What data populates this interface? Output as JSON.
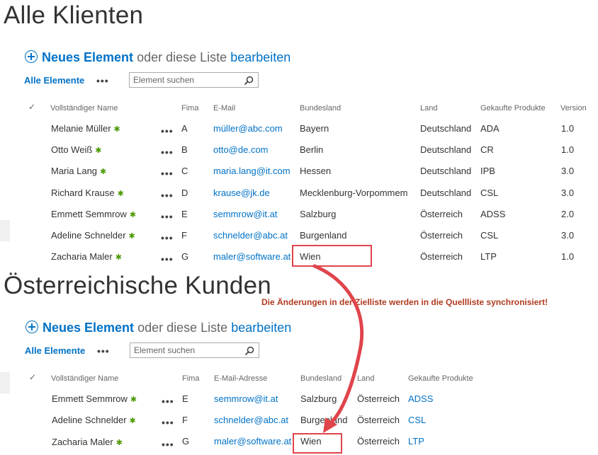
{
  "list1": {
    "title": "Alle Klienten",
    "new_item_label": "Neues Element",
    "or_text": "oder diese Liste",
    "edit_label": "bearbeiten",
    "view_label": "Alle Elemente",
    "more_label": "•••",
    "search_placeholder": "Element suchen",
    "columns": [
      "Vollständiger Name",
      "Fima",
      "E-Mail",
      "Bundesland",
      "Land",
      "Gekaufte Produkte",
      "Version"
    ],
    "rows": [
      {
        "name": "Melanie Müller",
        "fima": "A",
        "email": "müller@abc.com",
        "bundesland": "Bayern",
        "land": "Deutschland",
        "produkt": "ADA",
        "version": "1.0"
      },
      {
        "name": "Otto Weiß",
        "fima": "B",
        "email": "otto@de.com",
        "bundesland": "Berlin",
        "land": "Deutschland",
        "produkt": "CR",
        "version": "1.0"
      },
      {
        "name": "Maria Lang",
        "fima": "C",
        "email": "maria.lang@it.com",
        "bundesland": "Hessen",
        "land": "Deutschland",
        "produkt": "IPB",
        "version": "3.0"
      },
      {
        "name": "Richard Krause",
        "fima": "D",
        "email": "krause@jk.de",
        "bundesland": "Mecklenburg-Vorpommem",
        "land": "Deutschland",
        "produkt": "CSL",
        "version": "3.0"
      },
      {
        "name": "Emmett Semmrow",
        "fima": "E",
        "email": "semmrow@it.at",
        "bundesland": "Salzburg",
        "land": "Österreich",
        "produkt": "ADSS",
        "version": "2.0"
      },
      {
        "name": "Adeline Schnelder",
        "fima": "F",
        "email": "schnelder@abc.at",
        "bundesland": "Burgenland",
        "land": "Österreich",
        "produkt": "CSL",
        "version": "3.0"
      },
      {
        "name": "Zacharia Maler",
        "fima": "G",
        "email": "maler@software.at",
        "bundesland": "Wien",
        "land": "Österreich",
        "produkt": "LTP",
        "version": "1.0"
      }
    ]
  },
  "list2": {
    "title": "Österreichische Kunden",
    "new_item_label": "Neues Element",
    "or_text": "oder diese Liste",
    "edit_label": "bearbeiten",
    "view_label": "Alle Elemente",
    "more_label": "•••",
    "search_placeholder": "Element suchen",
    "columns": [
      "Vollständiger Name",
      "Fima",
      "E-Mail-Adresse",
      "Bundesland",
      "Land",
      "Gekaufte Produkte"
    ],
    "rows": [
      {
        "name": "Emmett Semmrow",
        "fima": "E",
        "email": "semmrow@it.at",
        "bundesland": "Salzburg",
        "land": "Österreich",
        "produkt": "ADSS"
      },
      {
        "name": "Adeline Schnelder",
        "fima": "F",
        "email": "schnelder@abc.at",
        "bundesland": "Burgenland",
        "land": "Österreich",
        "produkt": "CSL"
      },
      {
        "name": "Zacharia Maler",
        "fima": "G",
        "email": "maler@software.at",
        "bundesland": "Wien",
        "land": "Österreich",
        "produkt": "LTP"
      }
    ]
  },
  "annotation": "Die Änderungen in der Zielliste werden in die Quellliste synchronisiert!",
  "new_marker": "✱",
  "colors": {
    "link": "#0072c6",
    "highlight": "#e0444b",
    "annotation": "#b03a1f",
    "new_marker": "#4e9a06"
  }
}
